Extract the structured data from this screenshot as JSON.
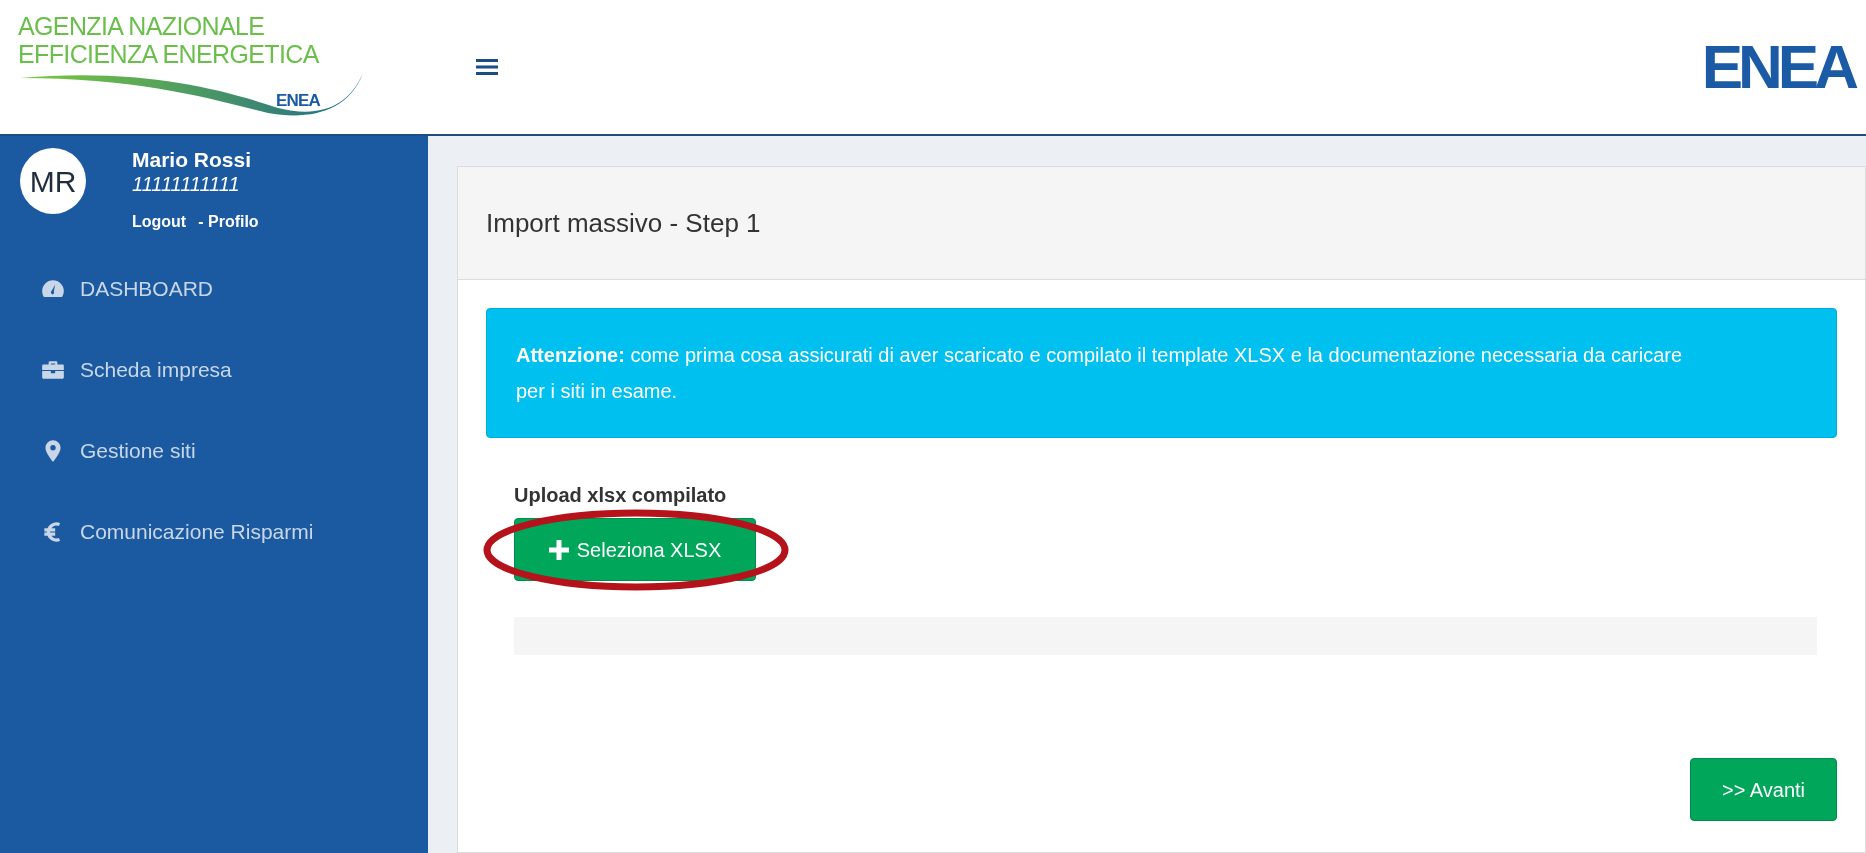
{
  "header": {
    "agency_lines": [
      "AGENZIA NAZIONALE",
      "EFFICIENZA ENERGETICA"
    ],
    "small_logo": "ENEA",
    "logo": "ENEA"
  },
  "user": {
    "initials": "MR",
    "name": "Mario Rossi",
    "code": "11111111111",
    "links": [
      {
        "label": "Logout"
      },
      {
        "label": "- Profilo"
      }
    ]
  },
  "sidebar": {
    "items": [
      {
        "label": "DASHBOARD",
        "kind": "dashboard"
      },
      {
        "label": "Scheda impresa",
        "kind": "briefcase"
      },
      {
        "label": "Gestione siti",
        "kind": "pin"
      },
      {
        "label": "Comunicazione Risparmi",
        "kind": "euro"
      }
    ]
  },
  "panel": {
    "title": "Import massivo - Step 1",
    "alert": "**Attenzione:** come prima cosa assicurati di aver scaricato e compilato il template XLSX e la documentazione necessaria da caricare per i siti in esame.",
    "upload_label": "Upload xlsx compilato",
    "select_button": "Seleziona XLSX",
    "highlighted": true,
    "next_button": ">> Avanti"
  }
}
